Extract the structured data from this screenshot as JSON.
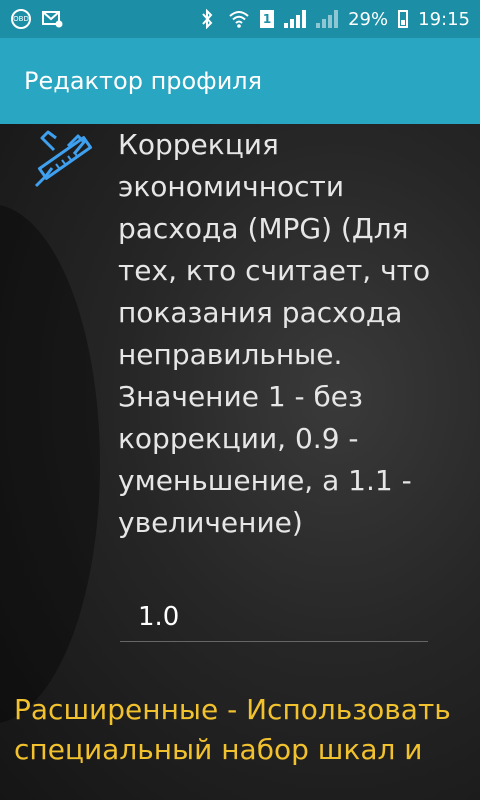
{
  "status_bar": {
    "obd_label": "OBD",
    "sim_label": "1",
    "battery": "29%",
    "time": "19:15",
    "icons": [
      "obd-icon",
      "mail-icon",
      "bluetooth-icon",
      "wifi-icon",
      "sim-icon",
      "signal-icon",
      "signal-icon",
      "battery-charging-icon"
    ]
  },
  "toolbar": {
    "title": "Редактор профиля"
  },
  "setting": {
    "icon": "caliper-icon",
    "description": "Коррекция экономичности расхода (MPG) (Для тех, кто считает, что показания расхода неправильные. Значение 1 - без коррекции, 0.9 - уменьшение, а 1.1 - увеличение)",
    "value": "1.0"
  },
  "advanced": {
    "text": "Расширенные - Использовать специальный набор шкал и"
  },
  "colors": {
    "status_bar": "#1c8fa6",
    "toolbar": "#29a6c1",
    "accent_text": "#f2c12e",
    "icon_blue": "#3fa0ef"
  }
}
